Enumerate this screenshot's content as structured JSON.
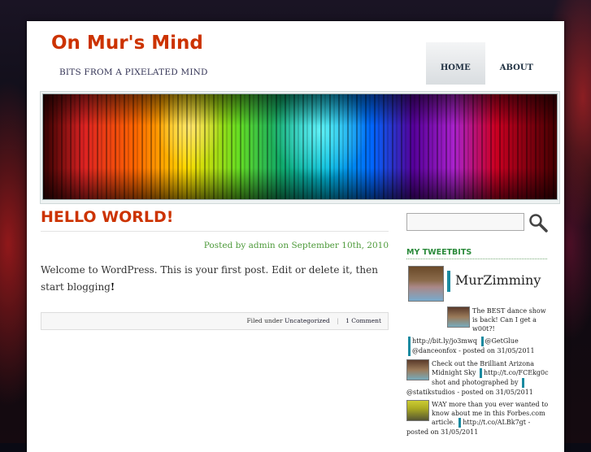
{
  "site": {
    "title": "On Mur's Mind",
    "tagline": "BITS FROM A PIXELATED MIND"
  },
  "nav": {
    "items": [
      {
        "label": "HOME",
        "active": true
      },
      {
        "label": "ABOUT",
        "active": false
      }
    ]
  },
  "post": {
    "title": "HELLO WORLD!",
    "meta": "Posted by admin on September 10th, 2010",
    "body_text": "Welcome to WordPress. This is your first post. Edit or delete it, then start blogging",
    "body_end": "!",
    "filed_under_label": "Filed under",
    "category": "Uncategorized",
    "comments": "1 Comment"
  },
  "sidebar": {
    "search_placeholder": "",
    "widget_title": "MY TWEETBITS",
    "twitter_name": "MurZimminy",
    "tweets": [
      {
        "text": "The BEST dance show is back! Can I get a w00t?!",
        "link": "http://bit.ly/jo3mwq",
        "mention1": "@GetGlue",
        "mention2": "@danceonfox",
        "date": "- posted on 31/05/2011"
      },
      {
        "text": "Check out the Brilliant Arizona Midnight Sky",
        "link": "http://t.co/FCEkg0c",
        "after": "shot and photographed by",
        "mention1": "@statikstudios",
        "date": "- posted on 31/05/2011"
      },
      {
        "text": "WAY more than you ever wanted to know about me in this Forbes.com article.",
        "link": "http://t.co/ALBk7gt",
        "date": "- posted on 31/05/2011"
      }
    ]
  },
  "colors": {
    "title_red": "#cc3300",
    "accent_green": "#2a8a3a",
    "twitter_bar": "#1a8aa0"
  }
}
